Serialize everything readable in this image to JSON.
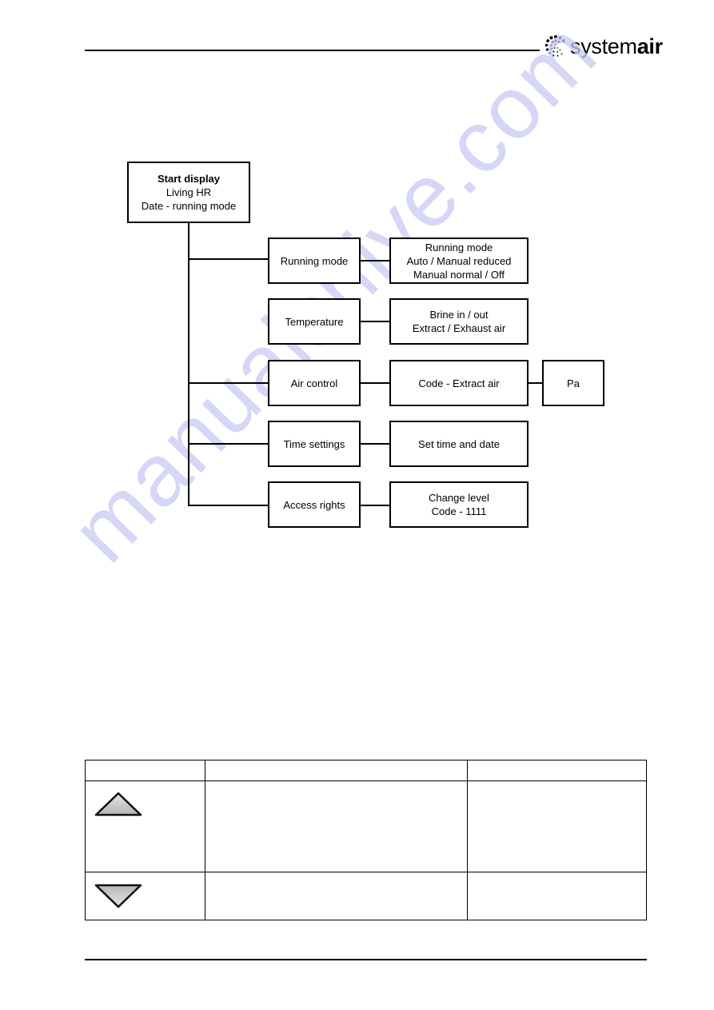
{
  "header": {
    "brand_regular": "system",
    "brand_bold": "air",
    "logo_icon": "dot-sunburst-logo"
  },
  "diagram": {
    "root": {
      "title": "Start display",
      "lines": [
        "Living HR",
        "Date - running mode"
      ]
    },
    "menu": [
      {
        "label": "Running mode",
        "connected_to_trunk": true,
        "children": [
          {
            "lines": [
              "Running mode",
              "Auto / Manual reduced",
              "Manual normal / Off"
            ]
          }
        ]
      },
      {
        "label": "Temperature",
        "connected_to_trunk": false,
        "children": [
          {
            "lines": [
              "Brine in / out",
              "Extract / Exhaust air"
            ]
          }
        ]
      },
      {
        "label": "Air control",
        "connected_to_trunk": true,
        "children": [
          {
            "lines": [
              "Code - Extract air"
            ]
          },
          {
            "lines": [
              "Pa"
            ]
          }
        ]
      },
      {
        "label": "Time settings",
        "connected_to_trunk": true,
        "children": [
          {
            "lines": [
              "Set time and date"
            ]
          }
        ]
      },
      {
        "label": "Access rights",
        "connected_to_trunk": true,
        "children": [
          {
            "lines": [
              "Change level",
              "Code - 1111"
            ]
          }
        ]
      }
    ]
  },
  "table": {
    "header": [
      "",
      "",
      ""
    ],
    "rows": [
      {
        "icon": "up-triangle-button-icon",
        "description": "",
        "note": ""
      },
      {
        "icon": "down-triangle-button-icon",
        "description": "",
        "note": ""
      }
    ]
  },
  "watermark": "manualshive.com"
}
